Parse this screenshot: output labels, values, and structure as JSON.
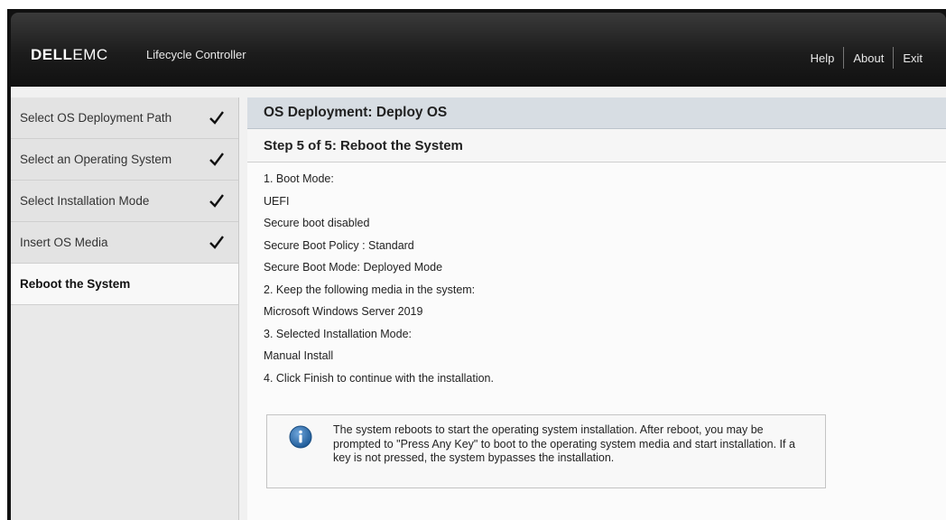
{
  "header": {
    "logo_dell": "DELL",
    "logo_emc": "EMC",
    "product": "Lifecycle Controller",
    "menu": {
      "help": "Help",
      "about": "About",
      "exit": "Exit"
    }
  },
  "sidebar": {
    "items": [
      {
        "label": "Select OS Deployment Path",
        "completed": true
      },
      {
        "label": "Select an Operating System",
        "completed": true
      },
      {
        "label": "Select Installation Mode",
        "completed": true
      },
      {
        "label": "Insert OS Media",
        "completed": true
      },
      {
        "label": "Reboot the System",
        "completed": false,
        "active": true
      }
    ]
  },
  "main": {
    "title": "OS Deployment: Deploy OS",
    "step": "Step 5 of 5: Reboot the System",
    "lines": [
      "1. Boot Mode:",
      "UEFI",
      "Secure boot disabled",
      "Secure Boot Policy : Standard",
      "Secure Boot Mode: Deployed Mode",
      "2. Keep the following media in the system:",
      "Microsoft Windows Server 2019",
      "3. Selected Installation Mode:",
      "Manual Install",
      "4. Click Finish to continue with the installation."
    ],
    "info": "The system reboots to start the operating system installation. After reboot, you may be prompted to \"Press Any Key\" to boot to the operating system media and start installation. If a key is not pressed, the system bypasses the installation."
  },
  "colors": {
    "info_icon": "#2f6fae",
    "title_bar": "#d7dde3",
    "header_bg": "#1c1c1c"
  },
  "icons": {
    "check": "check-icon",
    "info": "info-icon"
  }
}
